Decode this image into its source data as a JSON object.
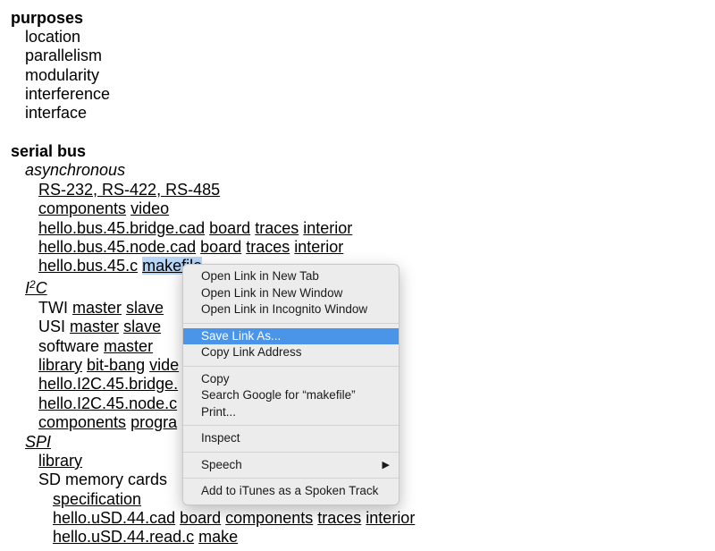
{
  "purposes": {
    "heading": "purposes",
    "items": [
      "location",
      "parallelism",
      "modularity",
      "interference",
      "interface"
    ]
  },
  "serial_bus": {
    "heading": "serial bus",
    "async": {
      "label": "asynchronous",
      "rs": "RS-232, RS-422, RS-485",
      "components": "components",
      "video": "video",
      "bridge_cad": "hello.bus.45.bridge.cad",
      "node_cad": "hello.bus.45.node.cad",
      "board": "board",
      "traces": "traces",
      "interior": "interior",
      "bus_c": "hello.bus.45.c",
      "makefile": "makefile"
    },
    "i2c": {
      "label_i": "I",
      "label_sup": "2",
      "label_c": "C",
      "twi": "TWI",
      "usi": "USI",
      "software": "software",
      "master": "master",
      "slave": "slave",
      "library": "library",
      "bitbang": "bit-bang",
      "video_partial": "vide",
      "bridge_partial": "hello.I2C.45.bridge.",
      "node_partial": "hello.I2C.45.node.c",
      "components": "components",
      "program_partial": "progra"
    },
    "spi": {
      "label": "SPI",
      "library": "library",
      "sd": "SD memory cards",
      "specification": "specification",
      "usd_cad": "hello.uSD.44.cad",
      "board": "board",
      "components": "components",
      "traces": "traces",
      "interior": "interior",
      "usd_read": "hello.uSD.44.read.c",
      "make": "make"
    }
  },
  "context_menu": {
    "items": [
      "Open Link in New Tab",
      "Open Link in New Window",
      "Open Link in Incognito Window",
      "Save Link As...",
      "Copy Link Address",
      "Copy",
      "Search Google for “makefile”",
      "Print...",
      "Inspect",
      "Speech",
      "Add to iTunes as a Spoken Track"
    ],
    "highlight_color": "#4a95e8"
  }
}
